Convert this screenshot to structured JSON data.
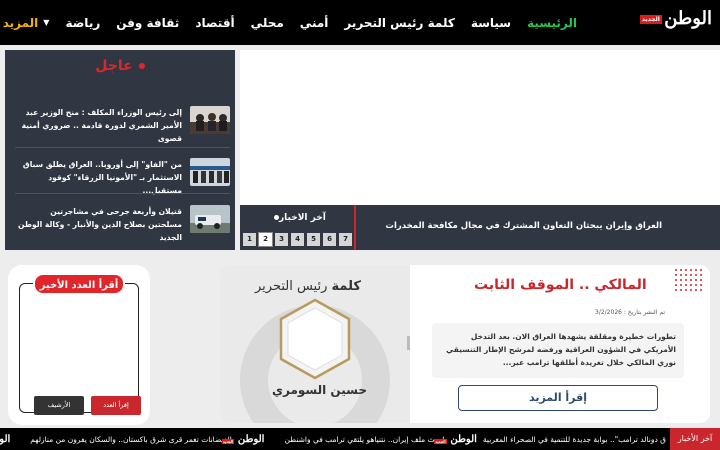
{
  "nav": {
    "logo": "الوطن",
    "logo_tag": "الجديد",
    "items": [
      "الرئيسية",
      "سياسة",
      "كلمة رئيس التحرير",
      "أمني",
      "محلي",
      "أقتصاد",
      "ثقافة وفن",
      "رياضة"
    ],
    "more_label": "المزيد",
    "active_color": "#23c653",
    "more_color": "#f4b400"
  },
  "breaking": {
    "title": "عاجل",
    "items": [
      {
        "text": "إلى رئيس الوزراء المكلف : منح الوزير عبد الأمير الشمري لدورة قادمة .. ضروري أمنية قصوى"
      },
      {
        "text": "من \"الفاو\" إلى أوروبا.. العراق يطلق سباق الاستثمار بـ \"الأمونيا الزرقاء\" كوقود مستقبل..."
      },
      {
        "text": "قتيلان وأربعة جرحى في مشاجرتين مسلحتين بصلاح الدين والأنبار - وكالة الوطن الجديد"
      }
    ]
  },
  "latest": {
    "label": "آخر الاخبار",
    "headline": "العراق وإيران يبحثان التعاون المشترك في مجال مكافحة المخدرات",
    "pages": [
      "1",
      "2",
      "3",
      "4",
      "5",
      "6",
      "7"
    ],
    "active_page": "2"
  },
  "magazine": {
    "title": "أقرأ العدد الأخير",
    "read_btn": "إقرأ العدد",
    "archive_btn": "الأرشيف"
  },
  "editor": {
    "heading_bold": "كلمة",
    "heading_rest": " رئيس التحرير",
    "name": "حسين السومري",
    "article_title": "المالكي .. الموقف الثابت",
    "date": "تم النشر بتاريخ : 3/2/2026",
    "excerpt": "تطورات خطيرة ومقلقة يشهدها العراق الان. بعد التدخل الأمريكي في الشؤون العراقية ورفضه لمرشح الإطار التنسيقي نوري المالكي خلال تغريدة أطلقها ترامب عبر...",
    "more_btn": "إقرأ المزيد"
  },
  "bottom_ticker": {
    "label": "آخر الأخبار",
    "items": [
      "ق دونالد ترامب\".. بوابة جديدة للتنمية في الصحراء المغربية",
      "لبحث ملف إيران.. نتنياهو يلتقي ترامب في واشنطن",
      "الفيضانات تغمر قرى شرق باكستان.. والسكان يفرون من منازلهم"
    ],
    "logo": "الوطن"
  }
}
